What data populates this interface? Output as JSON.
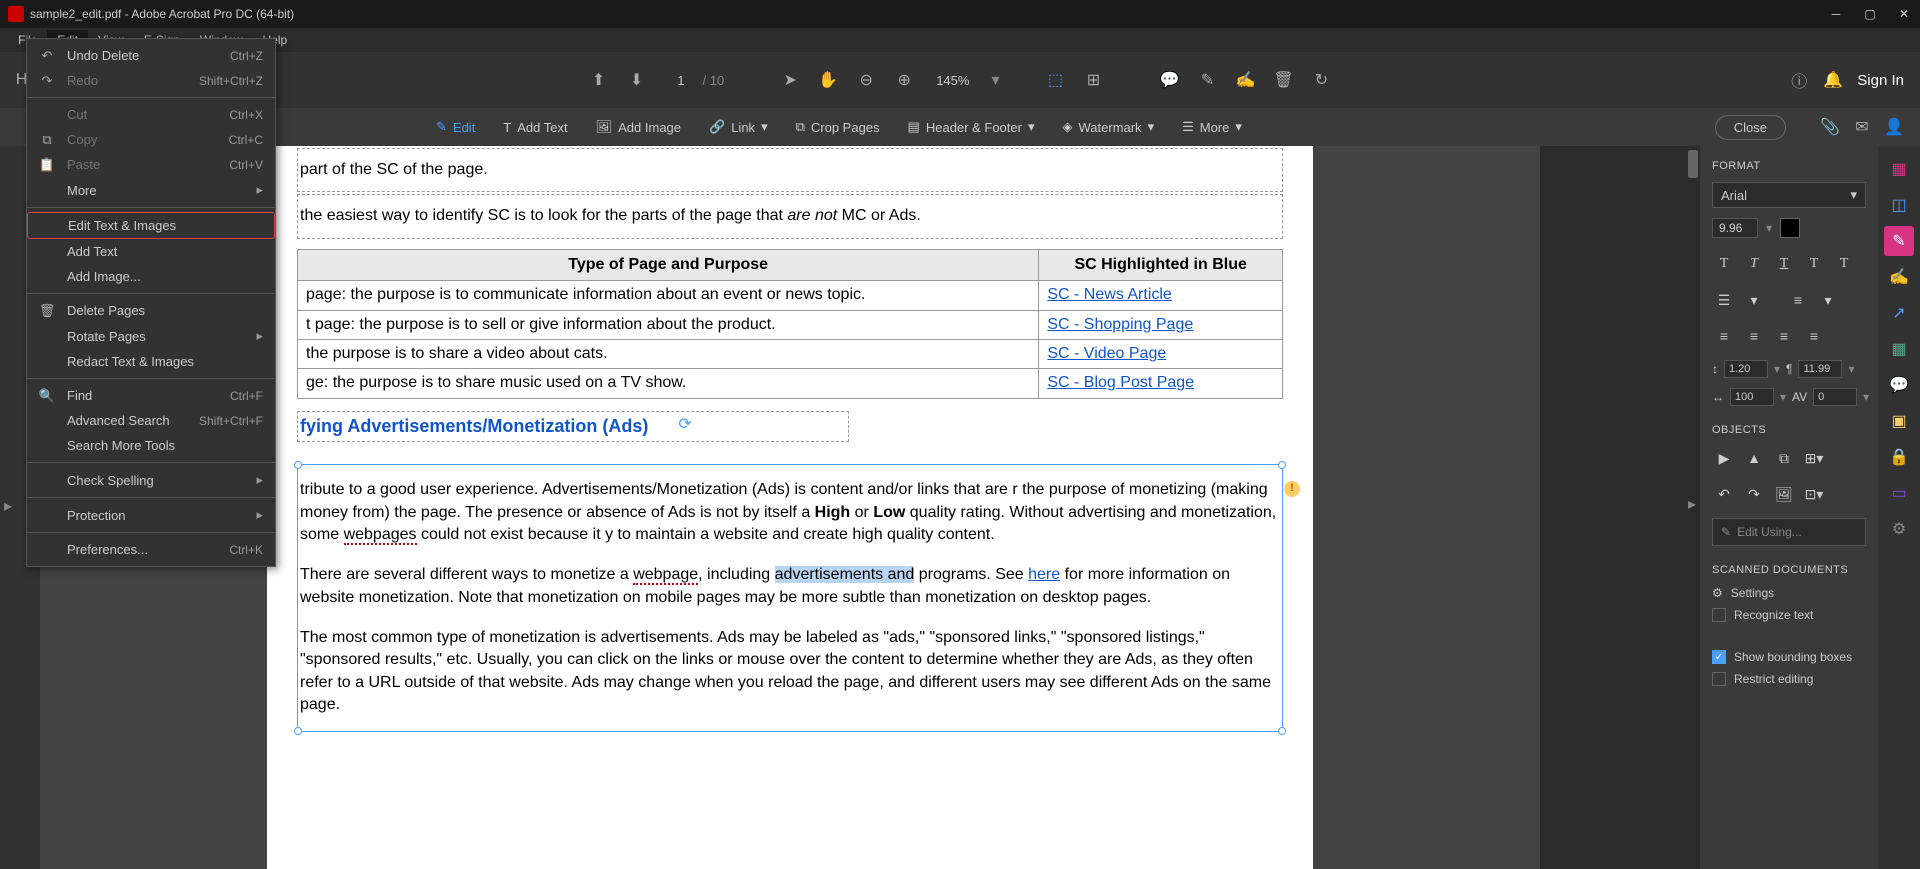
{
  "titlebar": {
    "title": "sample2_edit.pdf - Adobe Acrobat Pro DC (64-bit)"
  },
  "menubar": {
    "items": [
      "File",
      "Edit",
      "View",
      "E-Sign",
      "Window",
      "Help"
    ]
  },
  "top_toolbar": {
    "page_current": "1",
    "page_total": "/  10",
    "zoom": "145%",
    "sign_in": "Sign In"
  },
  "edit_toolbar": {
    "edit": "Edit",
    "add_text": "Add Text",
    "add_image": "Add Image",
    "link": "Link",
    "crop": "Crop Pages",
    "header_footer": "Header & Footer",
    "watermark": "Watermark",
    "more": "More",
    "close": "Close"
  },
  "edit_menu": {
    "undo": "Undo Delete",
    "undo_sc": "Ctrl+Z",
    "redo": "Redo",
    "redo_sc": "Shift+Ctrl+Z",
    "cut": "Cut",
    "cut_sc": "Ctrl+X",
    "copy": "Copy",
    "copy_sc": "Ctrl+C",
    "paste": "Paste",
    "paste_sc": "Ctrl+V",
    "more": "More",
    "edit_ti": "Edit Text & Images",
    "add_text": "Add Text",
    "add_image": "Add Image...",
    "delete_pages": "Delete Pages",
    "rotate_pages": "Rotate Pages",
    "redact": "Redact Text & Images",
    "find": "Find",
    "find_sc": "Ctrl+F",
    "adv_search": "Advanced Search",
    "adv_search_sc": "Shift+Ctrl+F",
    "search_more": "Search More Tools",
    "spelling": "Check Spelling",
    "protection": "Protection",
    "prefs": "Preferences...",
    "prefs_sc": "Ctrl+K"
  },
  "doc": {
    "l1": "part of the SC of the page.",
    "l2a": "the easiest way to identify SC is to look for the parts of the page that ",
    "l2b": "are not",
    "l2c": " MC or Ads.",
    "th1": "Type of Page and Purpose",
    "th2": "SC Highlighted in Blue",
    "r1a": "page: the purpose is to communicate information about an event or news topic.",
    "r1b": "SC - News Article",
    "r2a": "t page: the purpose is to sell or give information about the product.",
    "r2b": "SC - Shopping Page",
    "r3a": "the purpose is to share a video about cats.",
    "r3b": "SC - Video Page",
    "r4a": "ge: the purpose is to share music used on a TV show.",
    "r4b": "SC - Blog Post Page",
    "h1": "fying Advertisements/Monetization (Ads)",
    "p1": "tribute to a good user experience.  Advertisements/Monetization (Ads) is content and/or links that are r the purpose of monetizing (making money from) the page.  The presence or absence of Ads is not by itself a ",
    "p1b": "High",
    "p1c": " or ",
    "p1d": "Low",
    "p1e": " quality rating.  Without advertising and monetization, some ",
    "p1f": "webpages",
    "p1g": " could not exist because it y to maintain a website and create high quality content.",
    "p2a": "There are several different ways to monetize a ",
    "p2b": "webpage",
    "p2c": ", including ",
    "p2d": "advertisements and",
    "p2e": " programs.  See ",
    "p2f": "here",
    "p2g": " for more information on website monetization.  Note that monetization on mobile pages may be more subtle than monetization on desktop pages.",
    "p3": "The most common type of monetization is advertisements.  Ads may be labeled as \"ads,\" \"sponsored links,\" \"sponsored listings,\" \"sponsored results,\" etc.  Usually, you can click on the links or mouse over the content to determine whether they are Ads, as they often refer to a URL outside of that website.  Ads may change when you reload the page, and different users may see different Ads on the same page."
  },
  "format": {
    "title": "FORMAT",
    "font": "Arial",
    "size": "9.96",
    "line_spacing": "1.20",
    "para_spacing": "11.99",
    "scale": "100",
    "tracking": "0",
    "objects_title": "OBJECTS",
    "edit_using": "Edit Using...",
    "scanned_title": "SCANNED DOCUMENTS",
    "settings": "Settings",
    "recognize": "Recognize text",
    "show_boxes": "Show bounding boxes",
    "restrict": "Restrict editing"
  }
}
